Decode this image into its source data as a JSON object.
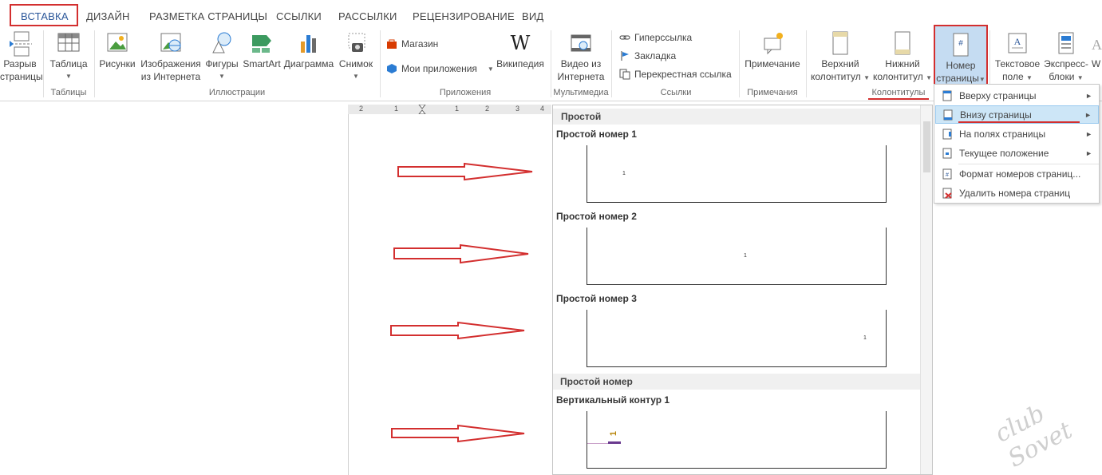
{
  "tabs": [
    {
      "label": "ВСТАВКА",
      "active": true
    },
    {
      "label": "ДИЗАЙН"
    },
    {
      "label": "РАЗМЕТКА СТРАНИЦЫ"
    },
    {
      "label": "ССЫЛКИ"
    },
    {
      "label": "РАССЫЛКИ"
    },
    {
      "label": "РЕЦЕНЗИРОВАНИЕ"
    },
    {
      "label": "ВИД"
    }
  ],
  "ribbon": {
    "page_break": [
      "Разрыв",
      "страницы"
    ],
    "table": "Таблица",
    "pictures": "Рисунки",
    "online_pictures": [
      "Изображения",
      "из Интернета"
    ],
    "shapes": "Фигуры",
    "smartart": "SmartArt",
    "chart": "Диаграмма",
    "screenshot": "Снимок",
    "store": "Магазин",
    "my_apps": "Мои приложения",
    "wikipedia": "Википедия",
    "online_video": [
      "Видео из",
      "Интернета"
    ],
    "hyperlink": "Гиперссылка",
    "bookmark": "Закладка",
    "cross_reference": "Перекрестная ссылка",
    "comment": "Примечание",
    "header": [
      "Верхний",
      "колонтитул"
    ],
    "footer": [
      "Нижний",
      "колонтитул"
    ],
    "page_number": [
      "Номер",
      "страницы"
    ],
    "text_box": [
      "Текстовое",
      "поле"
    ],
    "quick_parts": [
      "Экспресс-",
      "блоки"
    ],
    "wordart": "W",
    "groups": {
      "tables": "Таблицы",
      "illustrations": "Иллюстрации",
      "apps": "Приложения",
      "media": "Мультимедиа",
      "links": "Ссылки",
      "comments": "Примечания",
      "header_footer": "Колонтитулы"
    }
  },
  "ruler": [
    "2",
    "1",
    "1",
    "2",
    "3",
    "4"
  ],
  "gallery": {
    "section1": "Простой",
    "item1": "Простой номер 1",
    "item2": "Простой номер 2",
    "item3": "Простой номер 3",
    "section2": "Простой номер",
    "item4": "Вертикальный контур 1",
    "sample_number": "1"
  },
  "submenu": [
    {
      "label": "Вверху страницы",
      "icon": "page-top-icon",
      "arrow": "►"
    },
    {
      "label": "Внизу страницы",
      "icon": "page-bottom-icon",
      "arrow": "►",
      "highlighted": true
    },
    {
      "label": "На полях страницы",
      "icon": "page-margin-icon",
      "arrow": "►"
    },
    {
      "label": "Текущее положение",
      "icon": "current-position-icon",
      "arrow": "►"
    },
    {
      "label": "Формат номеров страниц...",
      "icon": "format-page-numbers-icon"
    },
    {
      "label": "Удалить номера страниц",
      "icon": "remove-page-numbers-icon"
    }
  ],
  "colors": {
    "accent": "#2b579a",
    "highlight_red": "#d32f2f",
    "menu_highlight": "#cde6f7"
  },
  "watermark": "club Sovet"
}
